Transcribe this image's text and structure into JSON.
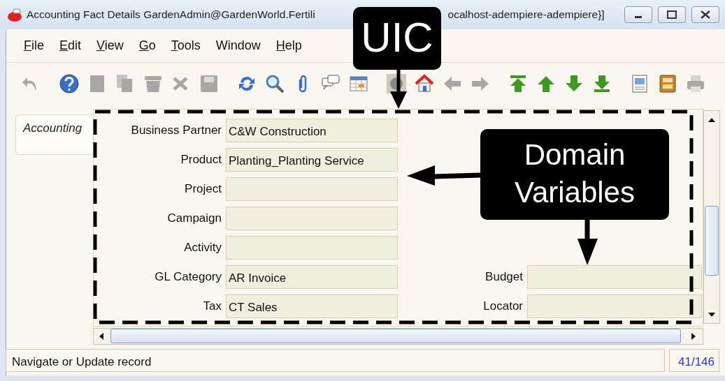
{
  "window": {
    "title_parts": [
      "Accounting Fact Details  GardenAdmin@GardenWorld.Fertili",
      "ocalhost-adempiere-adempiere}]"
    ]
  },
  "menu": [
    {
      "label": "File",
      "underlined": true
    },
    {
      "label": "Edit",
      "underlined": true
    },
    {
      "label": "View",
      "underlined": true
    },
    {
      "label": "Go",
      "underlined": true
    },
    {
      "label": "Tools",
      "underlined": true
    },
    {
      "label": "Window",
      "underlined": false
    },
    {
      "label": "Help",
      "underlined": true
    }
  ],
  "toolbar_groups": [
    [
      {
        "kind": "undo",
        "disabled": true
      }
    ],
    [
      {
        "kind": "help",
        "disabled": false
      },
      {
        "kind": "new",
        "disabled": true
      },
      {
        "kind": "copy",
        "disabled": true
      },
      {
        "kind": "delete",
        "disabled": true
      },
      {
        "kind": "delete-selection",
        "disabled": true
      },
      {
        "kind": "save",
        "disabled": true
      }
    ],
    [
      {
        "kind": "refresh",
        "disabled": false
      },
      {
        "kind": "find",
        "disabled": false
      },
      {
        "kind": "attach",
        "disabled": false
      },
      {
        "kind": "chat",
        "disabled": false
      },
      {
        "kind": "grid",
        "disabled": false
      }
    ],
    [
      {
        "kind": "history",
        "disabled": true
      },
      {
        "kind": "home",
        "disabled": false
      },
      {
        "kind": "previous",
        "disabled": true
      },
      {
        "kind": "next",
        "disabled": true
      }
    ],
    [
      {
        "kind": "first",
        "disabled": false
      },
      {
        "kind": "up",
        "disabled": false
      },
      {
        "kind": "down",
        "disabled": false
      },
      {
        "kind": "last",
        "disabled": false
      }
    ],
    [
      {
        "kind": "report",
        "disabled": false
      },
      {
        "kind": "archive",
        "disabled": false
      },
      {
        "kind": "print",
        "disabled": true
      }
    ]
  ],
  "tabs": [
    {
      "label": "Accounting",
      "selected": true
    }
  ],
  "left_fields": [
    {
      "label": "Business Partner",
      "value": "C&W Construction"
    },
    {
      "label": "Product",
      "value": "Planting_Planting Service"
    },
    {
      "label": "Project"
    },
    {
      "label": "Campaign"
    },
    {
      "label": "Activity"
    },
    {
      "label": "GL Category",
      "value": "AR Invoice"
    },
    {
      "label": "Tax",
      "value": "CT Sales"
    }
  ],
  "right_fields": [
    {
      "label": "Budget"
    },
    {
      "label": "Locator"
    }
  ],
  "status_bar": {
    "message": "Navigate or Update record",
    "record_count": "41/146"
  },
  "annotations": [
    {
      "kind": "uic",
      "text": "UIC"
    },
    {
      "kind": "domain",
      "text": "Domain Variables"
    }
  ]
}
